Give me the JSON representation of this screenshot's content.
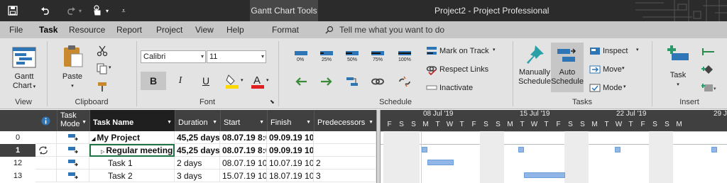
{
  "window": {
    "context_tab": "Gantt Chart Tools",
    "title": "Project2  -  Project Professional"
  },
  "tabs": [
    "File",
    "Task",
    "Resource",
    "Report",
    "Project",
    "View",
    "Help",
    "Format"
  ],
  "active_tab": "Task",
  "tell_me": "Tell me what you want to do",
  "ribbon": {
    "view": {
      "gantt_line1": "Gantt",
      "gantt_line2": "Chart",
      "group": "View"
    },
    "clipboard": {
      "paste": "Paste",
      "group": "Clipboard"
    },
    "font": {
      "font_name": "Calibri",
      "font_size": "11",
      "bold": "B",
      "italic": "I",
      "underline": "U",
      "group": "Font"
    },
    "schedule": {
      "pct": [
        "0%",
        "25%",
        "50%",
        "75%",
        "100%"
      ],
      "mark_on_track": "Mark on Track",
      "respect_links": "Respect Links",
      "inactivate": "Inactivate",
      "group": "Schedule"
    },
    "tasks": {
      "manual_line1": "Manually",
      "manual_line2": "Schedule",
      "auto_line1": "Auto",
      "auto_line2": "Schedule",
      "inspect": "Inspect",
      "move": "Move",
      "mode": "Mode",
      "group": "Tasks"
    },
    "insert": {
      "task": "Task",
      "group": "Insert"
    }
  },
  "table": {
    "headers": {
      "task_mode_line1": "Task",
      "task_mode_line2": "Mode",
      "task_name": "Task Name",
      "duration": "Duration",
      "start": "Start",
      "finish": "Finish",
      "predecessors": "Predecessors"
    },
    "rows": [
      {
        "id": "0",
        "name": "My Project",
        "duration": "45,25 days",
        "start": "08.07.19 8:00",
        "finish": "09.09.19 10:00",
        "pred": ""
      },
      {
        "id": "1",
        "name": "Regular meeting",
        "duration": "45,25 days",
        "start": "08.07.19 8:00",
        "finish": "09.09.19 10:00",
        "pred": ""
      },
      {
        "id": "12",
        "name": "Task 1",
        "duration": "2 days",
        "start": "08.07.19 10:00",
        "finish": "10.07.19 10:00",
        "pred": "2"
      },
      {
        "id": "13",
        "name": "Task 2",
        "duration": "3 days",
        "start": "15.07.19 10:00",
        "finish": "18.07.19 10:00",
        "pred": "3"
      }
    ]
  },
  "timeline": {
    "weeks": [
      "08 Jul '19",
      "15 Jul '19",
      "22 Jul '19",
      "29 J"
    ],
    "days": [
      "F",
      "S",
      "S",
      "M",
      "T",
      "W",
      "T",
      "F",
      "S",
      "S",
      "M",
      "T",
      "W",
      "T",
      "F",
      "S",
      "S",
      "M",
      "T",
      "W",
      "T",
      "F",
      "S",
      "S",
      "M"
    ],
    "bar_color": "#8fb6e6"
  }
}
